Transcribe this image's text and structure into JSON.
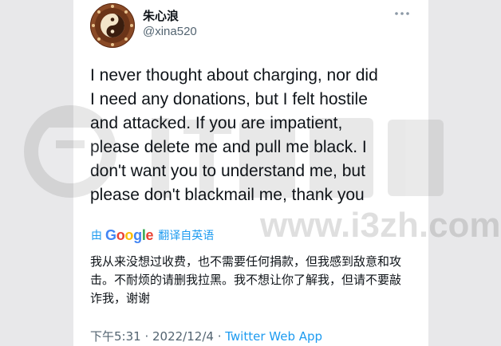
{
  "tweet": {
    "author": {
      "display_name": "朱心浪",
      "handle": "@xina520",
      "avatar_icon": "yin-yang-avatar-icon"
    },
    "more_icon": "more-horizontal-icon",
    "text": "I never thought about charging, nor did\nI need any donations, but I felt hostile\nand attacked. If you are impatient,\nplease delete me and pull me black. I\ndon't want you to understand me, but\nplease don't blackmail me, thank you",
    "translation_label": {
      "by": "由",
      "provider_letters": [
        "G",
        "o",
        "o",
        "g",
        "l",
        "e"
      ],
      "action": "翻译自英语"
    },
    "translation": "我从来没想过收费，也不需要任何捐款，但我感到敌意和攻击。不耐烦的请删我拉黑。我不想让你了解我，但请不要敲诈我，谢谢",
    "meta": {
      "time": "下午5:31",
      "separator": " · ",
      "date": "2022/12/4",
      "source": "Twitter Web App"
    }
  },
  "watermark": {
    "site": "www.i3zh.com"
  },
  "colors": {
    "link_blue": "#1d9bf0",
    "secondary_gray": "#536471",
    "text_dark": "#0f1419"
  }
}
